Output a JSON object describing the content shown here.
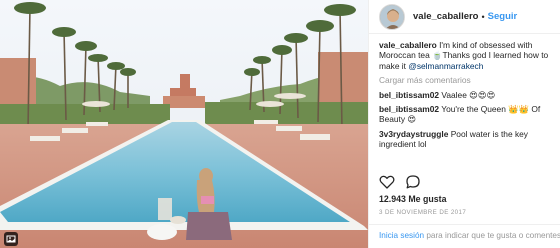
{
  "post": {
    "username": "vale_caballero",
    "separator": "•",
    "follow_label": "Seguir",
    "load_more_label": "Cargar más comentarios",
    "caption": {
      "user": "vale_caballero",
      "text": "I'm kind of obsessed with Moroccan tea 🍵Thanks god I learned how to make it ",
      "mention": "@selmanmarrakech"
    },
    "comments": [
      {
        "user": "bel_ibtissam02",
        "text": "Vaalee 😍😍😍"
      },
      {
        "user": "bel_ibtissam02",
        "text": "You're the Queen 👑👑 Of Beauty 😍"
      },
      {
        "user": "3v3rydaystruggle",
        "text": "Pool water is the key ingredient lol"
      }
    ],
    "likes": "12.943 Me gusta",
    "date": "3 de noviembre de 2017",
    "footer": {
      "login_label": "Inicia sesión",
      "rest_text": " para indicar que te gusta o comentes."
    },
    "icons": {
      "like": "heart-icon",
      "comment": "comment-icon",
      "photo_tag": "image-icon"
    }
  }
}
